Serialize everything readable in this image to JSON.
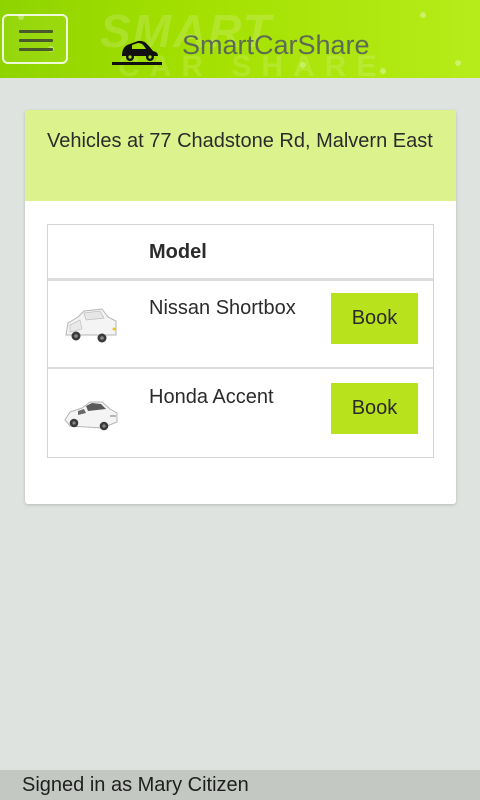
{
  "header": {
    "app_title": "SmartCarShare",
    "menu_icon": "hamburger-menu-icon",
    "logo_icon": "car-logo-icon",
    "watermark_line1": "SMART",
    "watermark_line2": "CAR SHARE"
  },
  "location": {
    "heading": "Vehicles at 77 Chadstone Rd, Malvern East"
  },
  "table": {
    "columns": [
      "",
      "Model",
      ""
    ],
    "rows": [
      {
        "model": "Nissan Shortbox",
        "book_label": "Book",
        "icon": "van-icon"
      },
      {
        "model": "Honda Accent",
        "book_label": "Book",
        "icon": "sedan-icon"
      }
    ]
  },
  "footer": {
    "status": "Signed in as Mary Citizen"
  },
  "colors": {
    "header_green": "#a3e000",
    "heading_green": "#dcf38d",
    "book_button": "#b8e21c",
    "background": "#dfe3e0"
  }
}
